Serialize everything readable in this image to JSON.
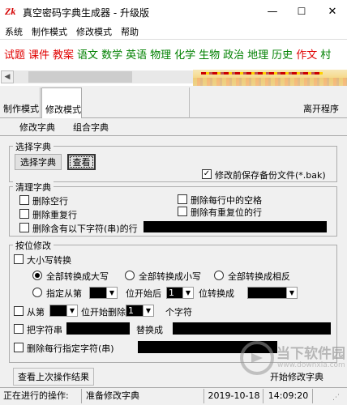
{
  "window": {
    "title": "真空密码字典生成器 - 升级版",
    "minimize": "—",
    "maximize": "☐",
    "close": "✕"
  },
  "menu": [
    "系统",
    "制作模式",
    "修改模式",
    "帮助"
  ],
  "subjects": [
    {
      "label": "试题",
      "color": "#e00000"
    },
    {
      "label": "课件",
      "color": "#e00000"
    },
    {
      "label": "教案",
      "color": "#e00000"
    },
    {
      "label": "语文",
      "color": "#008000"
    },
    {
      "label": "数学",
      "color": "#008000"
    },
    {
      "label": "英语",
      "color": "#008000"
    },
    {
      "label": "物理",
      "color": "#008000"
    },
    {
      "label": "化学",
      "color": "#008000"
    },
    {
      "label": "生物",
      "color": "#008000"
    },
    {
      "label": "政治",
      "color": "#008000"
    },
    {
      "label": "地理",
      "color": "#008000"
    },
    {
      "label": "历史",
      "color": "#008000"
    },
    {
      "label": "作文",
      "color": "#e00000"
    },
    {
      "label": "村",
      "color": "#008000"
    }
  ],
  "tabs": {
    "make": "制作模式",
    "modify": "修改模式",
    "exit": "离开程序"
  },
  "subtabs": {
    "modify_dict": "修改字典",
    "combine_dict": "组合字典"
  },
  "select_dict": {
    "title": "选择字典",
    "select_button": "选择字典",
    "view_button": "查看",
    "backup_label": "修改前保存备份文件(*.bak)",
    "backup_checked": true
  },
  "clean_dict": {
    "title": "清理字典",
    "delete_empty": "删除空行",
    "delete_spaces": "删除每行中的空格",
    "delete_duplicates": "删除重复行",
    "delete_repeated_chars": "删除有重复位的行",
    "delete_containing": "删除含有以下字符(串)的行"
  },
  "positional": {
    "title": "按位修改",
    "case_convert": "大小写转换",
    "all_upper": "全部转换成大写",
    "all_lower": "全部转换成小写",
    "all_swap": "全部转换成相反",
    "specify_from": "指定从第",
    "start_after": "位开始后",
    "convert_to": "位转换成",
    "pos_value": "1",
    "delete_from": "从第",
    "delete_start": "位开始删除",
    "delete_count_value": "1",
    "char_unit": "个字符",
    "replace_string": "把字符串",
    "replace_with": "替换成",
    "delete_each_line": "删除每行指定字符(串)"
  },
  "bottom": {
    "view_last": "查看上次操作结果",
    "start_modify": "开始修改字典"
  },
  "status": {
    "label": "正在进行的操作:",
    "value": "准备修改字典",
    "date": "2019-10-18",
    "time": "14:09:20"
  },
  "watermark": {
    "text": "当下软件园",
    "subtext": "www.downxia.com"
  }
}
